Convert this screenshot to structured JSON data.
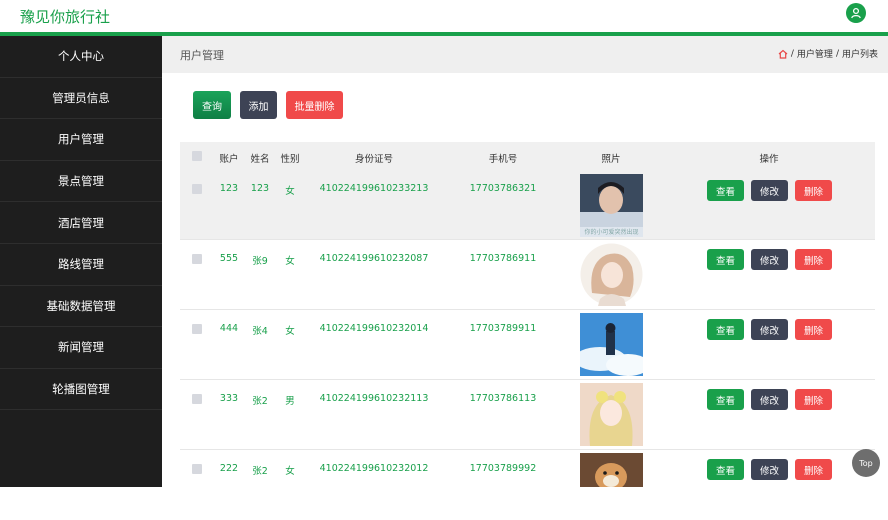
{
  "app": {
    "title": "豫见你旅行社"
  },
  "sidebar": {
    "items": [
      {
        "label": "个人中心"
      },
      {
        "label": "管理员信息"
      },
      {
        "label": "用户管理"
      },
      {
        "label": "景点管理"
      },
      {
        "label": "酒店管理"
      },
      {
        "label": "路线管理"
      },
      {
        "label": "基础数据管理"
      },
      {
        "label": "新闻管理"
      },
      {
        "label": "轮播图管理"
      }
    ]
  },
  "page": {
    "title": "用户管理",
    "breadcrumb": {
      "sep": "/",
      "parent": "用户管理",
      "current": "用户列表"
    }
  },
  "toolbar": {
    "query_label": "查询",
    "add_label": "添加",
    "batch_delete_label": "批量删除"
  },
  "table": {
    "headers": {
      "account": "账户",
      "name": "姓名",
      "gender": "性别",
      "id_card": "身份证号",
      "phone": "手机号",
      "photo": "照片",
      "actions": "操作"
    },
    "action_labels": {
      "view": "查看",
      "edit": "修改",
      "delete": "删除"
    },
    "rows": [
      {
        "account": "123",
        "name": "123",
        "gender": "女",
        "id_card": "410224199610233213",
        "phone": "17703786321",
        "photo_caption": "你的小可爱突然出现"
      },
      {
        "account": "555",
        "name": "张9",
        "gender": "女",
        "id_card": "410224199610232087",
        "phone": "17703786911"
      },
      {
        "account": "444",
        "name": "张4",
        "gender": "女",
        "id_card": "410224199610232014",
        "phone": "17703789911"
      },
      {
        "account": "333",
        "name": "张2",
        "gender": "男",
        "id_card": "410224199610232113",
        "phone": "17703786113"
      },
      {
        "account": "222",
        "name": "张2",
        "gender": "女",
        "id_card": "410224199610232012",
        "phone": "17703789992"
      }
    ]
  },
  "back_to_top": "Top",
  "colors": {
    "brand_green": "#19a04b",
    "dark_button": "#3d4355",
    "danger_red": "#f04a4a",
    "sidebar_bg": "#1e1e1e"
  }
}
